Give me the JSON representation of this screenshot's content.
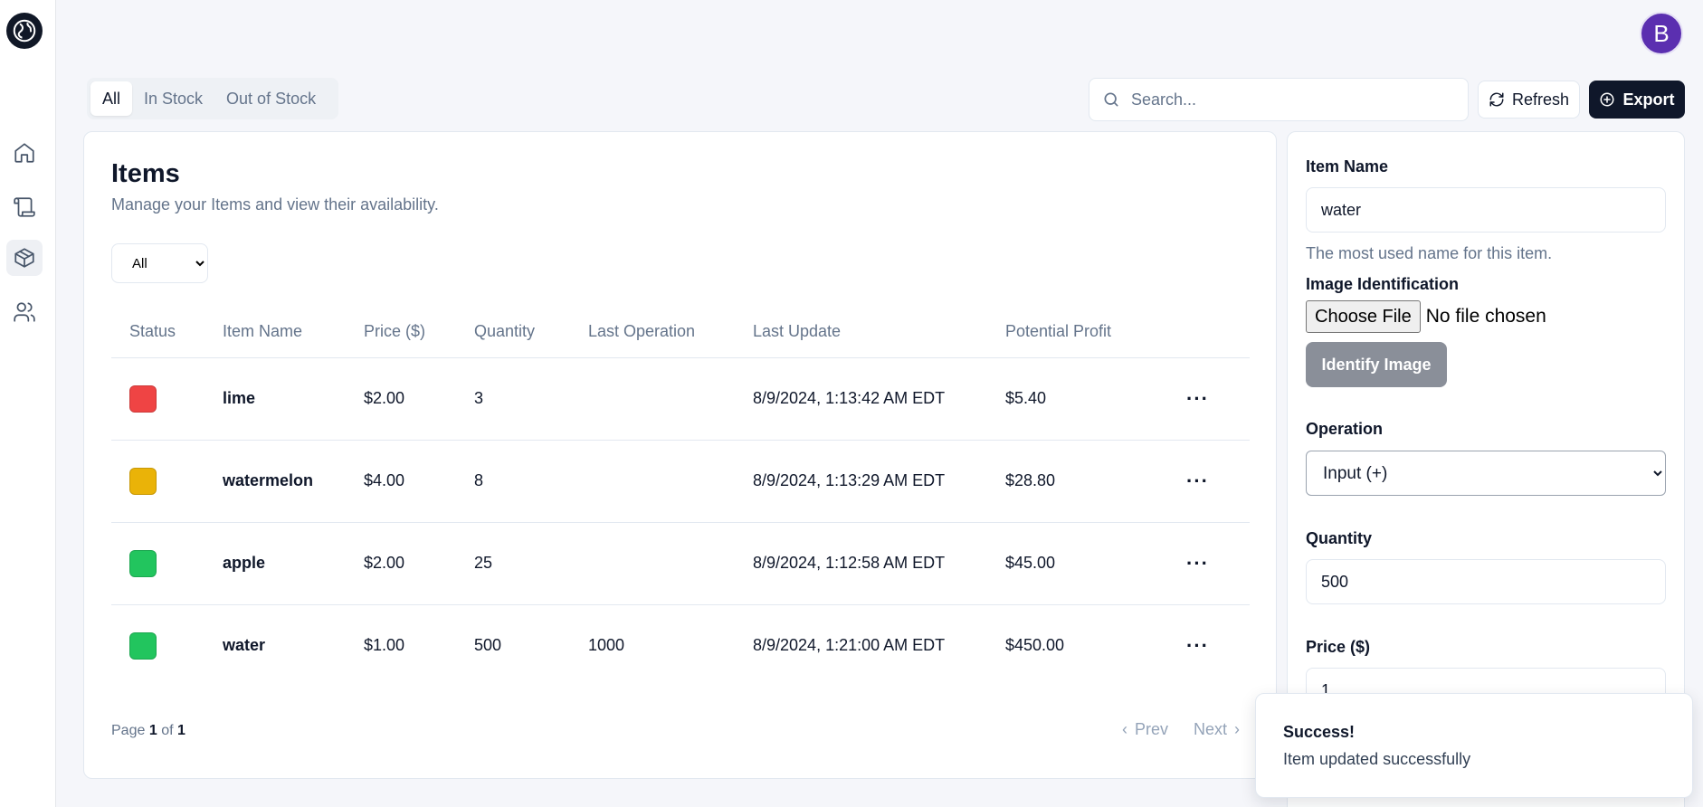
{
  "header": {
    "avatar_initial": "B"
  },
  "tabs": [
    {
      "label": "All",
      "active": true
    },
    {
      "label": "In Stock",
      "active": false
    },
    {
      "label": "Out of Stock",
      "active": false
    }
  ],
  "search": {
    "placeholder": "Search..."
  },
  "toolbar": {
    "refresh_label": "Refresh",
    "export_label": "Export"
  },
  "items_card": {
    "title": "Items",
    "subtitle": "Manage your Items and view their availability.",
    "filter_selected": "All",
    "columns": [
      "Status",
      "Item Name",
      "Price ($)",
      "Quantity",
      "Last Operation",
      "Last Update",
      "Potential Profit"
    ],
    "rows": [
      {
        "status_color": "#ef4444",
        "name": "lime",
        "price": "$2.00",
        "quantity": "3",
        "last_operation": "",
        "last_update": "8/9/2024, 1:13:42 AM EDT",
        "profit": "$5.40"
      },
      {
        "status_color": "#eab308",
        "name": "watermelon",
        "price": "$4.00",
        "quantity": "8",
        "last_operation": "",
        "last_update": "8/9/2024, 1:13:29 AM EDT",
        "profit": "$28.80"
      },
      {
        "status_color": "#22c55e",
        "name": "apple",
        "price": "$2.00",
        "quantity": "25",
        "last_operation": "",
        "last_update": "8/9/2024, 1:12:58 AM EDT",
        "profit": "$45.00"
      },
      {
        "status_color": "#22c55e",
        "name": "water",
        "price": "$1.00",
        "quantity": "500",
        "last_operation": "1000",
        "last_update": "8/9/2024, 1:21:00 AM EDT",
        "profit": "$450.00"
      }
    ],
    "pagination": {
      "page_word": "Page",
      "current": "1",
      "of_word": "of",
      "total": "1",
      "prev_label": "Prev",
      "next_label": "Next"
    }
  },
  "form": {
    "item_name_label": "Item Name",
    "item_name_value": "water",
    "item_name_hint": "The most used name for this item.",
    "image_label": "Image Identification",
    "choose_file_label": "Choose File",
    "file_status": "No file chosen",
    "identify_label": "Identify Image",
    "operation_label": "Operation",
    "operation_value": "Input (+)",
    "quantity_label": "Quantity",
    "quantity_value": "500",
    "price_label": "Price ($)",
    "price_value": "1"
  },
  "toast": {
    "title": "Success!",
    "message": "Item updated successfully"
  },
  "icons": {
    "logo": "globe-logo-icon",
    "nav": [
      "home-icon",
      "scroll-icon",
      "package-icon",
      "users-icon"
    ],
    "search": "search-icon",
    "refresh": "refresh-icon",
    "export": "plus-circle-icon"
  }
}
